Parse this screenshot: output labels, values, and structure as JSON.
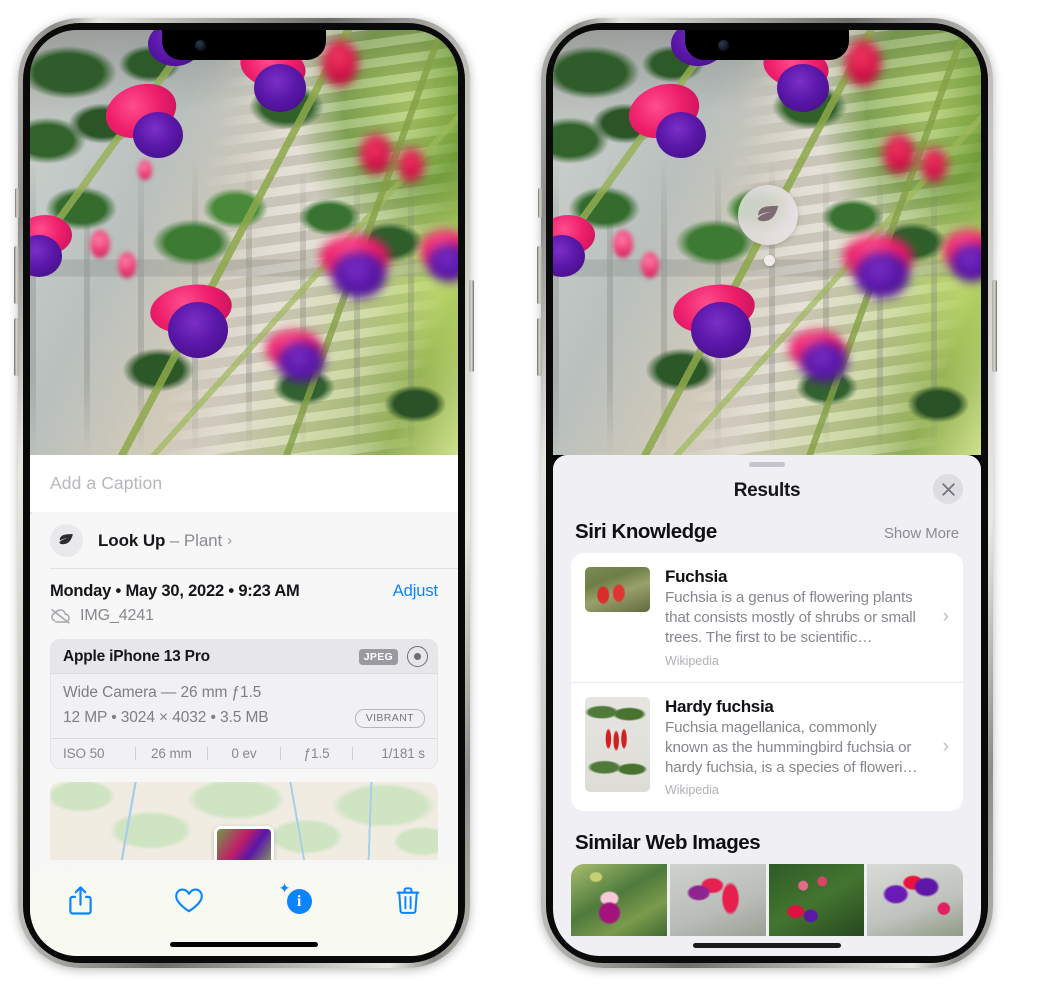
{
  "left_phone": {
    "photo": {
      "alt_name": "fuchsia-flowers-photo"
    },
    "caption_placeholder": "Add a Caption",
    "lookup": {
      "icon": "leaf-icon",
      "label": "Look Up",
      "dash": " – ",
      "subject": "Plant",
      "chevron": "›"
    },
    "meta": {
      "date_line": "Monday • May 30, 2022 • 9:23 AM",
      "adjust_label": "Adjust",
      "cloud_icon": "cloud-slash-icon",
      "filename": "IMG_4241"
    },
    "camera_card": {
      "device": "Apple iPhone 13 Pro",
      "format_badge": "JPEG",
      "aperture_icon": "aperture-icon",
      "lens_line": "Wide Camera — 26 mm ƒ1.5",
      "specs_line": "12 MP • 3024 × 4032 • 3.5 MB",
      "style_badge": "VIBRANT",
      "exif": [
        "ISO 50",
        "26 mm",
        "0 ev",
        "ƒ1.5",
        "1/181 s"
      ]
    },
    "toolbar": {
      "share_label": "share-icon",
      "favorite_label": "heart-icon",
      "info_label": "info-sparkle-icon",
      "delete_label": "trash-icon",
      "accent_color": "#0a84ff"
    }
  },
  "right_phone": {
    "vlu_badge": {
      "icon": "leaf-icon"
    },
    "sheet": {
      "title": "Results",
      "close_icon": "close-icon",
      "sections": [
        {
          "title": "Siri Knowledge",
          "action": "Show More",
          "cards": [
            {
              "title": "Fuchsia",
              "desc": "Fuchsia is a genus of flowering plants that consists mostly of shrubs or small trees. The first to be scientific…",
              "source": "Wikipedia",
              "chevron": "›"
            },
            {
              "title": "Hardy fuchsia",
              "desc": "Fuchsia magellanica, commonly known as the hummingbird fuchsia or hardy fuchsia, is a species of floweri…",
              "source": "Wikipedia",
              "chevron": "›"
            }
          ]
        },
        {
          "title": "Similar Web Images",
          "action": ""
        }
      ]
    }
  }
}
